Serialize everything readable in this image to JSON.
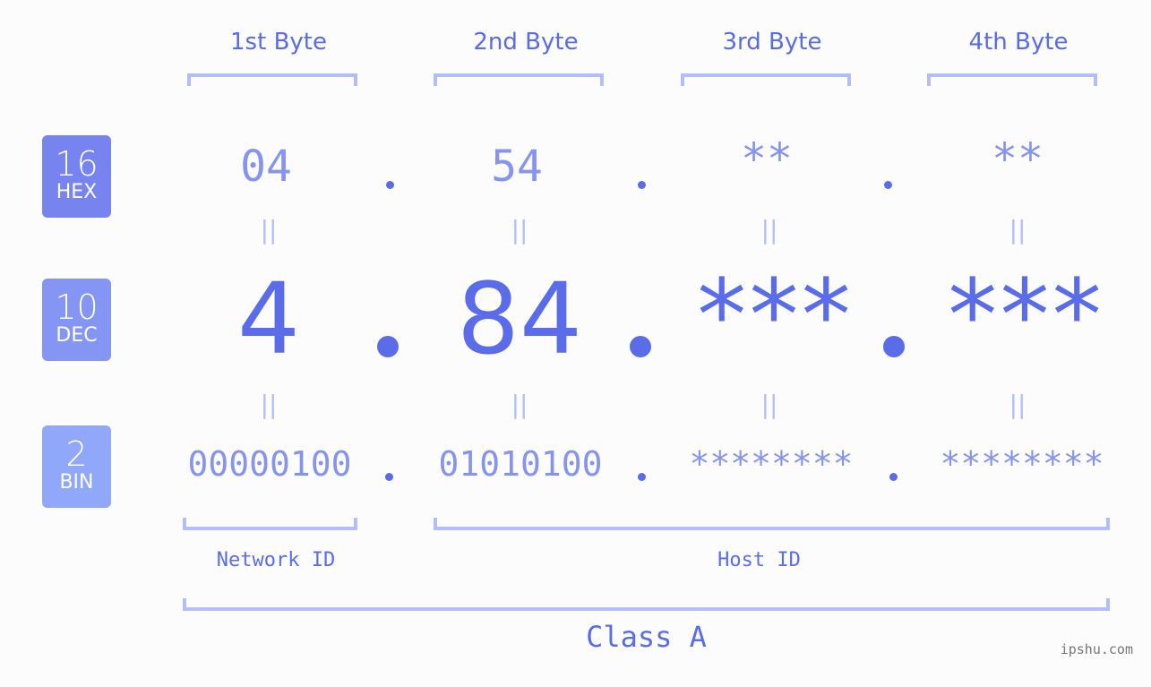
{
  "byte_headers": [
    "1st Byte",
    "2nd Byte",
    "3rd Byte",
    "4th Byte"
  ],
  "badges": {
    "hex": {
      "num": "16",
      "label": "HEX",
      "color": "#7783ee"
    },
    "dec": {
      "num": "10",
      "label": "DEC",
      "color": "#8595f3"
    },
    "bin": {
      "num": "2",
      "label": "BIN",
      "color": "#90a7fa"
    }
  },
  "hex_values": [
    "04",
    "54",
    "**",
    "**"
  ],
  "dec_values": [
    "4",
    "84",
    "***",
    "***"
  ],
  "bin_values": [
    "00000100",
    "01010100",
    "********",
    "********"
  ],
  "equals_symbol": "||",
  "network_id_label": "Network ID",
  "host_id_label": "Host ID",
  "class_label": "Class A",
  "watermark": "ipshu.com",
  "colors": {
    "primary": "#5b6ce8",
    "light_text": "#8794ee",
    "bracket": "#b3bdf7",
    "background": "#fbfcfb"
  }
}
